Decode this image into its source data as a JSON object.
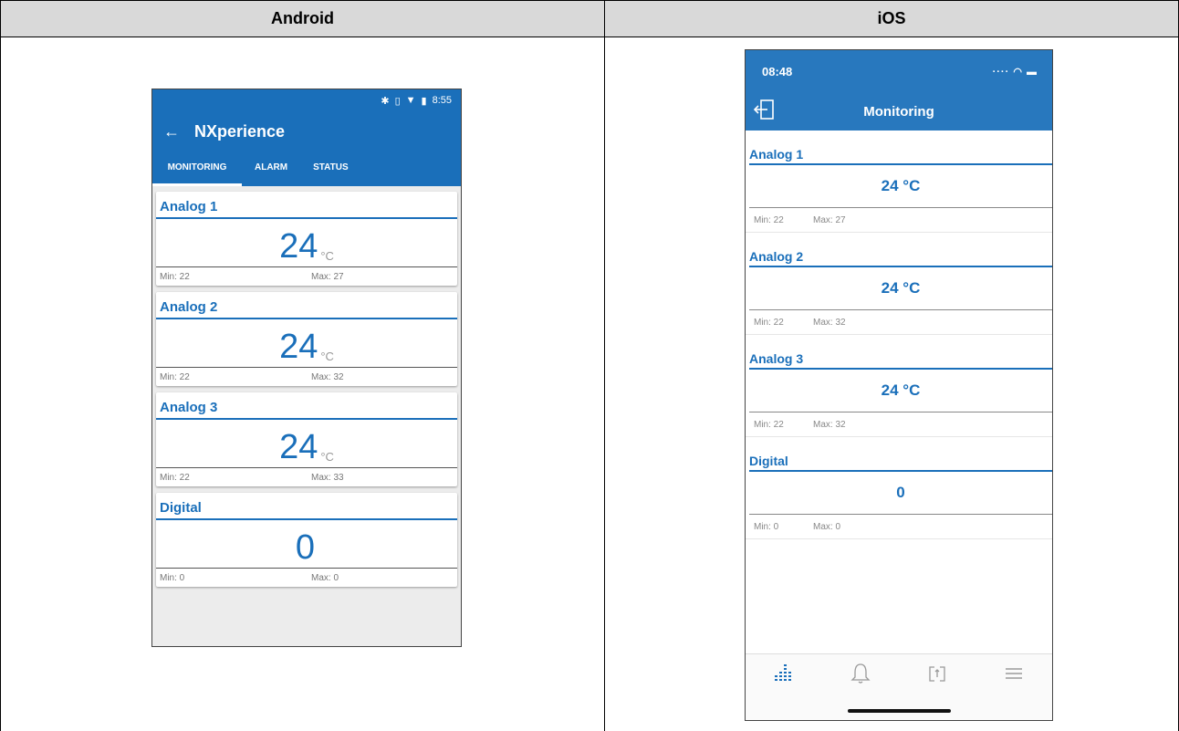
{
  "table": {
    "col_android": "Android",
    "col_ios": "iOS"
  },
  "colors": {
    "primary": "#1a6fba",
    "ios_bar": "#2878be"
  },
  "android": {
    "status_time": "8:55",
    "status_icons": [
      "bluetooth-icon",
      "vibrate-icon",
      "wifi-icon",
      "battery-icon"
    ],
    "app_title": "NXperience",
    "tabs": [
      {
        "label": "MONITORING",
        "active": true
      },
      {
        "label": "ALARM",
        "active": false
      },
      {
        "label": "STATUS",
        "active": false
      }
    ],
    "cards": [
      {
        "title": "Analog 1",
        "value": "24",
        "unit": "°C",
        "min": "Min: 22",
        "max": "Max: 27"
      },
      {
        "title": "Analog 2",
        "value": "24",
        "unit": "°C",
        "min": "Min: 22",
        "max": "Max: 32"
      },
      {
        "title": "Analog 3",
        "value": "24",
        "unit": "°C",
        "min": "Min: 22",
        "max": "Max: 33"
      },
      {
        "title": "Digital",
        "value": "0",
        "unit": "",
        "min": "Min: 0",
        "max": "Max: 0"
      }
    ]
  },
  "ios": {
    "status_time": "08:48",
    "status_icons": [
      "signal-icon",
      "wifi-icon",
      "battery-icon"
    ],
    "nav_title": "Monitoring",
    "sections": [
      {
        "title": "Analog 1",
        "value": "24 °C",
        "min": "Min: 22",
        "max": "Max: 27"
      },
      {
        "title": "Analog 2",
        "value": "24 °C",
        "min": "Min: 22",
        "max": "Max: 32"
      },
      {
        "title": "Analog 3",
        "value": "24 °C",
        "min": "Min: 22",
        "max": "Max: 32"
      },
      {
        "title": "Digital",
        "value": "0",
        "min": "Min: 0",
        "max": "Max: 0"
      }
    ],
    "tabbar": [
      "monitoring-icon",
      "bell-icon",
      "refresh-icon",
      "menu-icon"
    ]
  }
}
